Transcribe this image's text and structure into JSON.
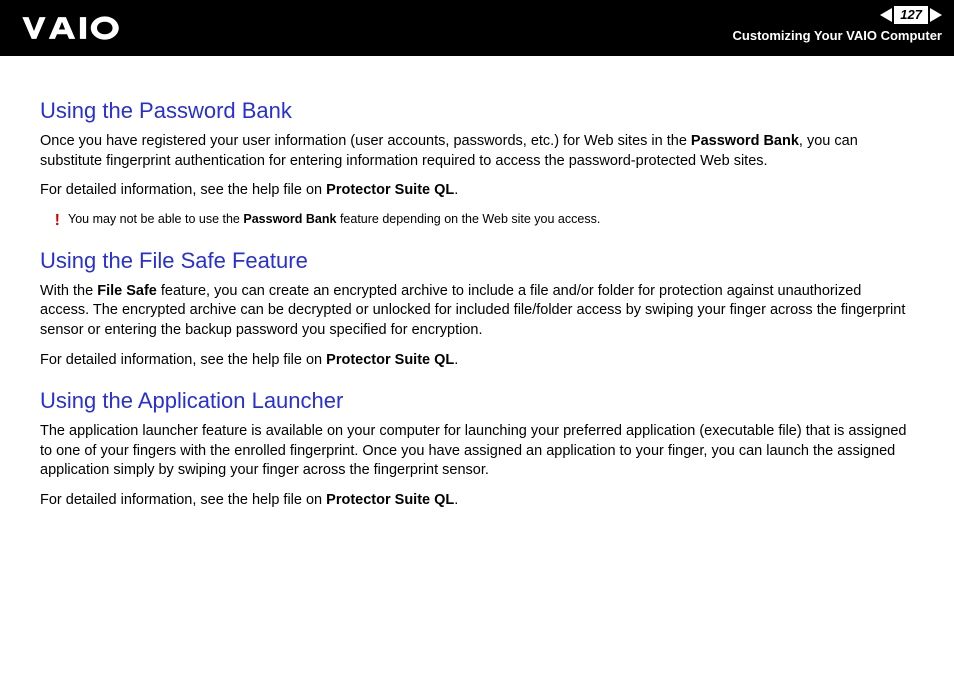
{
  "header": {
    "page_number": "127",
    "breadcrumb": "Customizing Your VAIO Computer"
  },
  "sections": {
    "pwbank": {
      "heading": "Using the Password Bank",
      "p1_a": "Once you have registered your user information (user accounts, passwords, etc.) for Web sites in the ",
      "p1_b": "Password Bank",
      "p1_c": ", you can substitute fingerprint authentication for entering information required to access the password-protected Web sites.",
      "p2_a": "For detailed information, see the help file on ",
      "p2_b": "Protector Suite QL",
      "p2_c": ".",
      "note_a": "You may not be able to use the ",
      "note_b": "Password Bank",
      "note_c": " feature depending on the Web site you access."
    },
    "filesafe": {
      "heading": "Using the File Safe Feature",
      "p1_a": "With the ",
      "p1_b": "File Safe",
      "p1_c": " feature, you can create an encrypted archive to include a file and/or folder for protection against unauthorized access. The encrypted archive can be decrypted or unlocked for included file/folder access by swiping your finger across the fingerprint sensor or entering the backup password you specified for encryption.",
      "p2_a": "For detailed information, see the help file on ",
      "p2_b": "Protector Suite QL",
      "p2_c": "."
    },
    "launcher": {
      "heading": "Using the Application Launcher",
      "p1": "The application launcher feature is available on your computer for launching your preferred application (executable file) that is assigned to one of your fingers with the enrolled fingerprint. Once you have assigned an application to your finger, you can launch the assigned application simply by swiping your finger across the fingerprint sensor.",
      "p2_a": "For detailed information, see the help file on ",
      "p2_b": "Protector Suite QL",
      "p2_c": "."
    }
  },
  "icons": {
    "bang": "!"
  }
}
